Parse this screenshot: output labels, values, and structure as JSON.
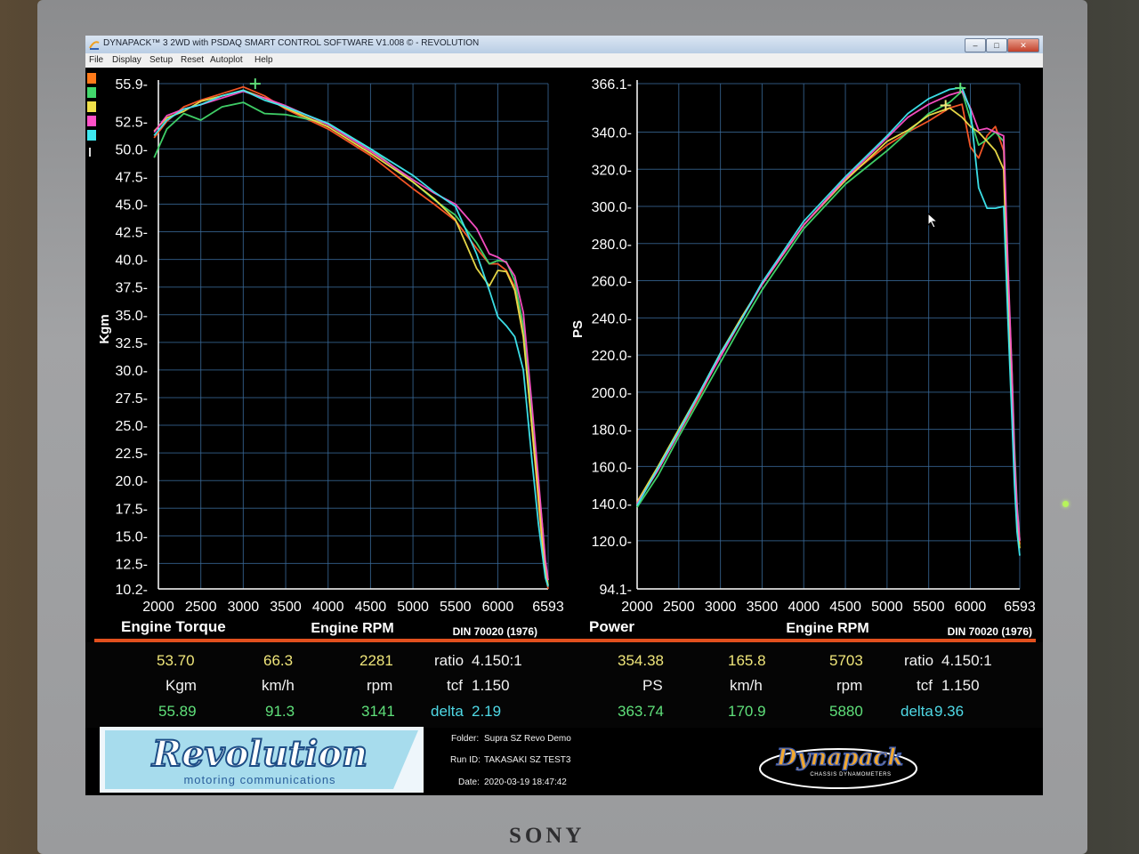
{
  "window": {
    "title": "DYNAPACK™ 3 2WD with PSDAQ SMART CONTROL SOFTWARE V1.008 © - REVOLUTION",
    "menu": [
      "File",
      "Display",
      "Setup",
      "Reset",
      "Autoplot",
      "Help"
    ],
    "buttons": [
      "–",
      "□",
      "✕"
    ]
  },
  "series_colors": [
    "#ff5a28",
    "#42d86c",
    "#f0e04a",
    "#ff50c8",
    "#3ee8f0"
  ],
  "legend_markers": [
    "#ff7a1a",
    "#42d86c",
    "#f0e04a",
    "#ff50c8",
    "#3ee8f0"
  ],
  "chart_data": [
    {
      "type": "line",
      "title": "Engine Torque",
      "xlabel": "Engine RPM",
      "ylabel": "Kgm",
      "note": "DIN 70020 (1976)",
      "xlim": [
        2000,
        6593
      ],
      "ylim": [
        10.2,
        55.9
      ],
      "x_ticks": [
        "2000",
        "2500",
        "3000",
        "3500",
        "4000",
        "4500",
        "5000",
        "5500",
        "6000",
        "6593"
      ],
      "y_ticks": [
        "55.9-",
        "52.5-",
        "50.0-",
        "47.5-",
        "45.0-",
        "42.5-",
        "40.0-",
        "37.5-",
        "35.0-",
        "32.5-",
        "30.0-",
        "27.5-",
        "25.0-",
        "22.5-",
        "20.0-",
        "17.5-",
        "15.0-",
        "12.5-",
        "10.2-"
      ],
      "y_tick_values": [
        55.9,
        52.5,
        50.0,
        47.5,
        45.0,
        42.5,
        40.0,
        37.5,
        35.0,
        32.5,
        30.0,
        27.5,
        25.0,
        22.5,
        20.0,
        17.5,
        15.0,
        12.5,
        10.2
      ],
      "x": [
        1950,
        2100,
        2300,
        2500,
        2750,
        3000,
        3250,
        3500,
        4000,
        4500,
        5000,
        5250,
        5500,
        5750,
        5900,
        6000,
        6100,
        6200,
        6300,
        6400,
        6480,
        6530,
        6560,
        6593
      ],
      "series": [
        {
          "values": [
            51.0,
            52.5,
            53.8,
            54.4,
            55.0,
            55.6,
            54.8,
            53.6,
            51.8,
            49.4,
            46.4,
            45.0,
            43.5,
            41.0,
            39.6,
            39.6,
            39.0,
            37.5,
            33.5,
            25.0,
            18.0,
            13.5,
            11.5,
            10.2
          ]
        },
        {
          "values": [
            49.2,
            51.8,
            53.2,
            52.6,
            53.8,
            54.2,
            53.2,
            53.1,
            52.3,
            50.0,
            47.0,
            45.4,
            44.0,
            41.5,
            39.6,
            39.9,
            39.8,
            38.0,
            34.0,
            26.0,
            19.5,
            15.5,
            12.5,
            11.0
          ]
        },
        {
          "values": [
            51.6,
            52.8,
            53.4,
            54.3,
            54.8,
            55.3,
            54.6,
            53.7,
            52.0,
            49.6,
            47.0,
            45.5,
            43.6,
            39.2,
            37.6,
            39.0,
            38.9,
            37.2,
            33.0,
            25.0,
            18.5,
            14.0,
            12.0,
            10.5
          ]
        },
        {
          "values": [
            51.5,
            53.0,
            53.6,
            54.0,
            54.6,
            55.2,
            54.6,
            53.9,
            52.2,
            49.8,
            47.2,
            46.0,
            45.0,
            42.8,
            40.5,
            40.2,
            39.7,
            38.5,
            35.2,
            27.0,
            20.0,
            15.5,
            12.8,
            11.0
          ]
        },
        {
          "values": [
            51.2,
            52.6,
            53.6,
            54.0,
            54.8,
            55.3,
            54.4,
            53.8,
            52.3,
            50.0,
            47.6,
            46.1,
            44.8,
            40.5,
            37.2,
            34.8,
            34.0,
            33.0,
            30.0,
            22.0,
            16.0,
            13.0,
            11.2,
            10.4
          ]
        }
      ]
    },
    {
      "type": "line",
      "title": "Power",
      "xlabel": "Engine RPM",
      "ylabel": "PS",
      "note": "DIN 70020 (1976)",
      "xlim": [
        2000,
        6593
      ],
      "ylim": [
        94.1,
        366.1
      ],
      "x_ticks": [
        "2000",
        "2500",
        "3000",
        "3500",
        "4000",
        "4500",
        "5000",
        "5500",
        "6000",
        "6593"
      ],
      "y_ticks": [
        "366.1-",
        "340.0-",
        "320.0-",
        "300.0-",
        "280.0-",
        "260.0-",
        "240.0-",
        "220.0-",
        "200.0-",
        "180.0-",
        "160.0-",
        "140.0-",
        "120.0-",
        "94.1-"
      ],
      "y_tick_values": [
        366.1,
        340.0,
        320.0,
        300.0,
        280.0,
        260.0,
        240.0,
        220.0,
        200.0,
        180.0,
        160.0,
        140.0,
        120.0,
        94.1
      ],
      "x": [
        2000,
        2250,
        2500,
        2750,
        3000,
        3250,
        3500,
        4000,
        4500,
        5000,
        5250,
        5500,
        5750,
        5900,
        6000,
        6100,
        6200,
        6300,
        6400,
        6450,
        6500,
        6530,
        6560,
        6593
      ],
      "series": [
        {
          "values": [
            140,
            158,
            178,
            198,
            220,
            240,
            258,
            290,
            315,
            333,
            340,
            346,
            353,
            355,
            332,
            326,
            338,
            343,
            330,
            260,
            200,
            160,
            135,
            118
          ]
        },
        {
          "values": [
            138,
            155,
            176,
            196,
            216,
            236,
            255,
            288,
            312,
            330,
            340,
            350,
            356,
            362,
            347,
            333,
            336,
            340,
            335,
            265,
            210,
            170,
            140,
            120
          ]
        },
        {
          "values": [
            141,
            160,
            180,
            200,
            221,
            240,
            258,
            290,
            314,
            335,
            341,
            349,
            353,
            348,
            343,
            340,
            335,
            330,
            320,
            250,
            195,
            155,
            130,
            116
          ]
        },
        {
          "values": [
            140,
            158,
            178,
            199,
            219,
            239,
            258,
            290,
            315,
            337,
            348,
            355,
            360,
            362,
            353,
            341,
            342,
            340,
            338,
            270,
            210,
            165,
            138,
            120
          ]
        },
        {
          "values": [
            139,
            159,
            179,
            200,
            221,
            239,
            259,
            292,
            316,
            338,
            350,
            358,
            363,
            364,
            352,
            310,
            299,
            299,
            300,
            240,
            185,
            150,
            125,
            112
          ]
        }
      ]
    }
  ],
  "readout": {
    "left": {
      "row1": [
        "53.70",
        "66.3",
        "2281"
      ],
      "row2": [
        "Kgm",
        "km/h",
        "rpm"
      ],
      "row3": [
        "55.89",
        "91.3",
        "3141"
      ],
      "ratio_label": "ratio",
      "ratio_value": "4.150:1",
      "tcf_label": "tcf",
      "tcf_value": "1.150",
      "delta_label": "delta",
      "delta_value": "2.19"
    },
    "right": {
      "row1": [
        "354.38",
        "165.8",
        "5703"
      ],
      "row2": [
        "PS",
        "km/h",
        "rpm"
      ],
      "row3": [
        "363.74",
        "170.9",
        "5880"
      ],
      "ratio_label": "ratio",
      "ratio_value": "4.150:1",
      "tcf_label": "tcf",
      "tcf_value": "1.150",
      "delta_label": "delta",
      "delta_value": "9.36"
    }
  },
  "run_info": {
    "folder_label": "Folder:",
    "folder_value": "Supra SZ Revo Demo",
    "runid_label": "Run ID:",
    "runid_value": "TAKASAKI SZ TEST3",
    "date_label": "Date:",
    "date_value": "2020-03-19 18:47:42"
  },
  "logos": {
    "revolution": "Revolution",
    "revolution_sub": "motoring communications",
    "dynapack": "Dynapack",
    "dynapack_sub": "CHASSIS DYNAMOMETERS"
  },
  "monitor": {
    "brand": "SONY"
  }
}
